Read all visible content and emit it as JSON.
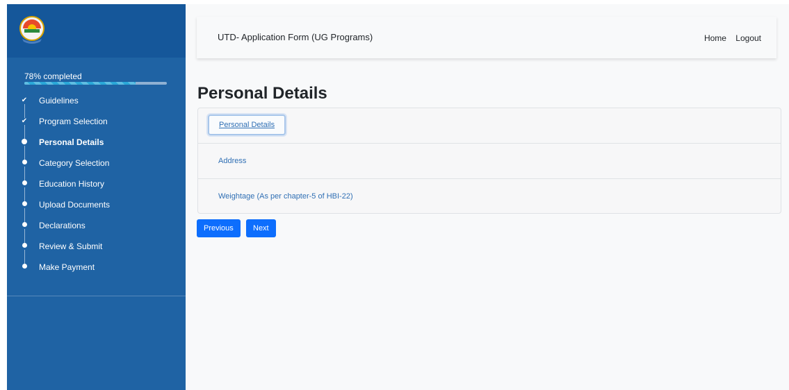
{
  "sidebar": {
    "progress": {
      "label": "78% completed",
      "value": 78
    },
    "steps": [
      {
        "label": "Guidelines",
        "status": "done"
      },
      {
        "label": "Program Selection",
        "status": "done"
      },
      {
        "label": "Personal Details",
        "status": "active"
      },
      {
        "label": "Category Selection",
        "status": "pending"
      },
      {
        "label": "Education History",
        "status": "pending"
      },
      {
        "label": "Upload Documents",
        "status": "pending"
      },
      {
        "label": "Declarations",
        "status": "pending"
      },
      {
        "label": "Review & Submit",
        "status": "pending"
      },
      {
        "label": "Make Payment",
        "status": "pending"
      }
    ]
  },
  "navbar": {
    "title": "UTD- Application Form (UG Programs)",
    "home": "Home",
    "logout": "Logout"
  },
  "main": {
    "heading": "Personal Details",
    "sections": [
      {
        "label": "Personal Details"
      },
      {
        "label": "Address"
      },
      {
        "label": "Weightage (As per chapter-5 of HBI-22)"
      }
    ],
    "previous_label": "Previous",
    "next_label": "Next"
  },
  "colors": {
    "sidebar": "#1f63a4",
    "sidebar_header": "#15579a",
    "primary_button": "#0d6efd",
    "link": "#2f6fb4"
  }
}
